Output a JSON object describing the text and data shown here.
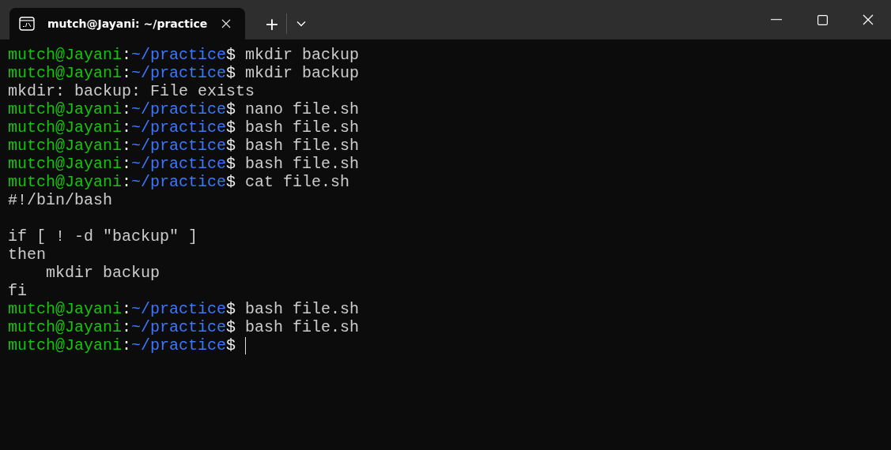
{
  "tabs": [
    {
      "title": "mutch@Jayani: ~/practice",
      "selected": true
    }
  ],
  "new_tab_label": "+",
  "lines": [
    {
      "kind": "prompt",
      "user": "mutch@Jayani",
      "colon": ":",
      "path": "~/practice",
      "sign": "$",
      "command": "mkdir backup",
      "cursor": false
    },
    {
      "kind": "prompt",
      "user": "mutch@Jayani",
      "colon": ":",
      "path": "~/practice",
      "sign": "$",
      "command": "mkdir backup",
      "cursor": false
    },
    {
      "kind": "output",
      "text": "mkdir: backup: File exists"
    },
    {
      "kind": "prompt",
      "user": "mutch@Jayani",
      "colon": ":",
      "path": "~/practice",
      "sign": "$",
      "command": "nano file.sh",
      "cursor": false
    },
    {
      "kind": "prompt",
      "user": "mutch@Jayani",
      "colon": ":",
      "path": "~/practice",
      "sign": "$",
      "command": "bash file.sh",
      "cursor": false
    },
    {
      "kind": "prompt",
      "user": "mutch@Jayani",
      "colon": ":",
      "path": "~/practice",
      "sign": "$",
      "command": "bash file.sh",
      "cursor": false
    },
    {
      "kind": "prompt",
      "user": "mutch@Jayani",
      "colon": ":",
      "path": "~/practice",
      "sign": "$",
      "command": "bash file.sh",
      "cursor": false
    },
    {
      "kind": "prompt",
      "user": "mutch@Jayani",
      "colon": ":",
      "path": "~/practice",
      "sign": "$",
      "command": "cat file.sh",
      "cursor": false
    },
    {
      "kind": "output",
      "text": "#!/bin/bash"
    },
    {
      "kind": "blank"
    },
    {
      "kind": "output",
      "text": "if [ ! -d \"backup\" ]"
    },
    {
      "kind": "output",
      "text": "then"
    },
    {
      "kind": "output",
      "text": "    mkdir backup"
    },
    {
      "kind": "output",
      "text": "fi"
    },
    {
      "kind": "prompt",
      "user": "mutch@Jayani",
      "colon": ":",
      "path": "~/practice",
      "sign": "$",
      "command": "bash file.sh",
      "cursor": false
    },
    {
      "kind": "prompt",
      "user": "mutch@Jayani",
      "colon": ":",
      "path": "~/practice",
      "sign": "$",
      "command": "bash file.sh",
      "cursor": false
    },
    {
      "kind": "prompt",
      "user": "mutch@Jayani",
      "colon": ":",
      "path": "~/practice",
      "sign": "$",
      "cursor": true
    }
  ]
}
